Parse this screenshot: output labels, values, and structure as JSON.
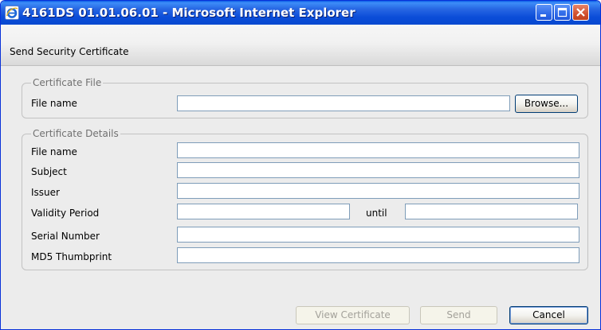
{
  "window": {
    "title": "4161DS 01.01.06.01 - Microsoft Internet Explorer",
    "icon": "internet-explorer-icon",
    "controls": {
      "minimize_icon": "minimize-icon",
      "maximize_icon": "maximize-icon",
      "close_icon": "close-icon"
    }
  },
  "header": {
    "title": "Send Security Certificate"
  },
  "certificate_file": {
    "legend": "Certificate File",
    "file_name_label": "File name",
    "file_name_value": "",
    "browse_label": "Browse..."
  },
  "certificate_details": {
    "legend": "Certificate Details",
    "fields": [
      {
        "label": "File name",
        "value": ""
      },
      {
        "label": "Subject",
        "value": ""
      },
      {
        "label": "Issuer",
        "value": ""
      },
      {
        "label": "Validity Period",
        "value": ""
      },
      {
        "label": "Serial Number",
        "value": ""
      },
      {
        "label": "MD5 Thumbprint",
        "value": ""
      }
    ],
    "until_label": "until",
    "validity_until_value": ""
  },
  "buttons": {
    "view_certificate": {
      "label": "View Certificate",
      "enabled": false
    },
    "send": {
      "label": "Send",
      "enabled": false
    },
    "cancel": {
      "label": "Cancel",
      "enabled": true
    }
  },
  "colors": {
    "titlebar_blue": "#0A4CD8",
    "window_bg": "#ECECEC",
    "textbox_border": "#7F9DB9",
    "group_border": "#C2C2C2",
    "legend_text": "#707070",
    "close_red": "#D2512F"
  }
}
